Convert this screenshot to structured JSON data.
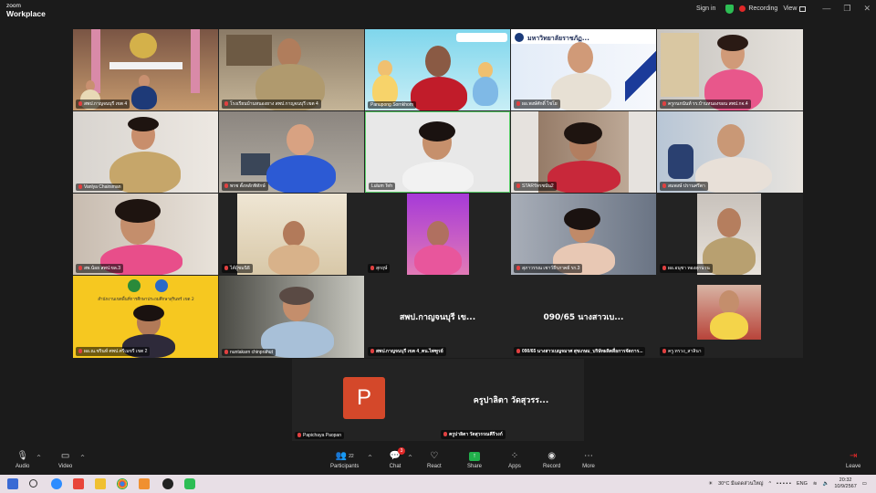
{
  "titlebar": {
    "brand_line1": "zoom",
    "brand_line2": "Workplace",
    "signin": "Sign in",
    "recording": "Recording",
    "view": "View",
    "colors": {
      "shield": "#2dbd54",
      "recording_dot": "#e02828"
    }
  },
  "tiles": {
    "t1": "สพป.กาญจนบุรี เขต 4",
    "t2": "โรงเรียนบ้านหนองยาง สพป.กาญจนบุรี เขต 4",
    "t3": "Panupong Sornkhom",
    "t4": "ผอ.พงษ์ศักดิ์ ไชโย",
    "t4_banner": "มหาวิทยาลัยราชภัฏ...",
    "t5": "ครูกนกนันท์ รร.บ้านหนองขอน สพป.กจ.4",
    "t6": "Vanlya Chairsman",
    "t7": "พรช ตั้งหลักพิทักษ์",
    "t8": "Lulum Teh",
    "t9": "STARรัทรชนัน2",
    "t10": "สมพงษ์ ปรานศรีตา",
    "t11": "สพ.น้อย สพป.ขล.3",
    "t12": "ไค้ผู้ชมนิธิ",
    "t13": "สุกฤษ์",
    "t14": "สุภาวรรณ เชาว์ธีรภาคย์ รก.3",
    "t15": "ผอ.อนุชา ทองสุกนวน",
    "t16": "ผอ.ณ.ชรินท์ ศพป.ศรีเมขรี เขต 2",
    "t16_sign": "สำนักงานเขตพื้นที่การศึกษาประถมศึกษาสุรินทร์ เขต 2",
    "t17": "nuntakarn chinprahut",
    "t18_big": "สพป.กาญจนบุรี เข...",
    "t18": "สพป.กาญจนบุรี เขต 4_คน.ไพฑูรย์",
    "t19_big": "090/65 นางสาวเบ...",
    "t19": "090/65 นางสาวเบญจมาศ สุขเกษม_บริษัทผลิตสื่อการจัดการ...",
    "t20": "ครู.ทรวง_สาลินา",
    "s1_initial": "P",
    "s1": "Papichaya Paopan",
    "s2_big": "ครูปาลิตา วัดสุวรร...",
    "s2": "ครูปาลิตา วัดสุวรรณคีรีวงก์"
  },
  "toolbar": {
    "audio": "Audio",
    "video": "Video",
    "participants": "Participants",
    "participants_count": "22",
    "chat": "Chat",
    "chat_badge": "3",
    "react": "React",
    "share": "Share",
    "apps": "Apps",
    "record": "Record",
    "more": "More",
    "leave": "Leave",
    "colors": {
      "share": "#21b04b",
      "leave": "#e02828",
      "chat_badge": "#e02828"
    }
  },
  "taskbar": {
    "weather": "30°C มีแดดส่วนใหญ่",
    "lang": "ENG",
    "time": "20:32",
    "date": "10/9/2567"
  }
}
